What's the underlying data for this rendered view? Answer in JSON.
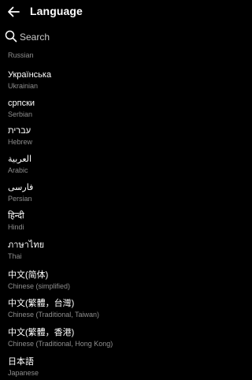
{
  "header": {
    "title": "Language",
    "back_icon": "arrow-left-icon"
  },
  "search": {
    "placeholder": "Search",
    "value": "",
    "icon": "search-icon"
  },
  "languages": [
    {
      "native": "",
      "english": "Russian"
    },
    {
      "native": "Українська",
      "english": "Ukrainian"
    },
    {
      "native": "српски",
      "english": "Serbian"
    },
    {
      "native": "עברית",
      "english": "Hebrew"
    },
    {
      "native": "العربية",
      "english": "Arabic"
    },
    {
      "native": "فارسی",
      "english": "Persian"
    },
    {
      "native": "हिन्दी",
      "english": "Hindi"
    },
    {
      "native": "ภาษาไทย",
      "english": "Thai"
    },
    {
      "native": "中文(简体)",
      "english": "Chinese (simplified)"
    },
    {
      "native": "中文(繁體，台灣)",
      "english": "Chinese (Traditional, Taiwan)"
    },
    {
      "native": "中文(繁體，香港)",
      "english": "Chinese (Traditional, Hong Kong)"
    },
    {
      "native": "日本語",
      "english": "Japanese"
    }
  ]
}
